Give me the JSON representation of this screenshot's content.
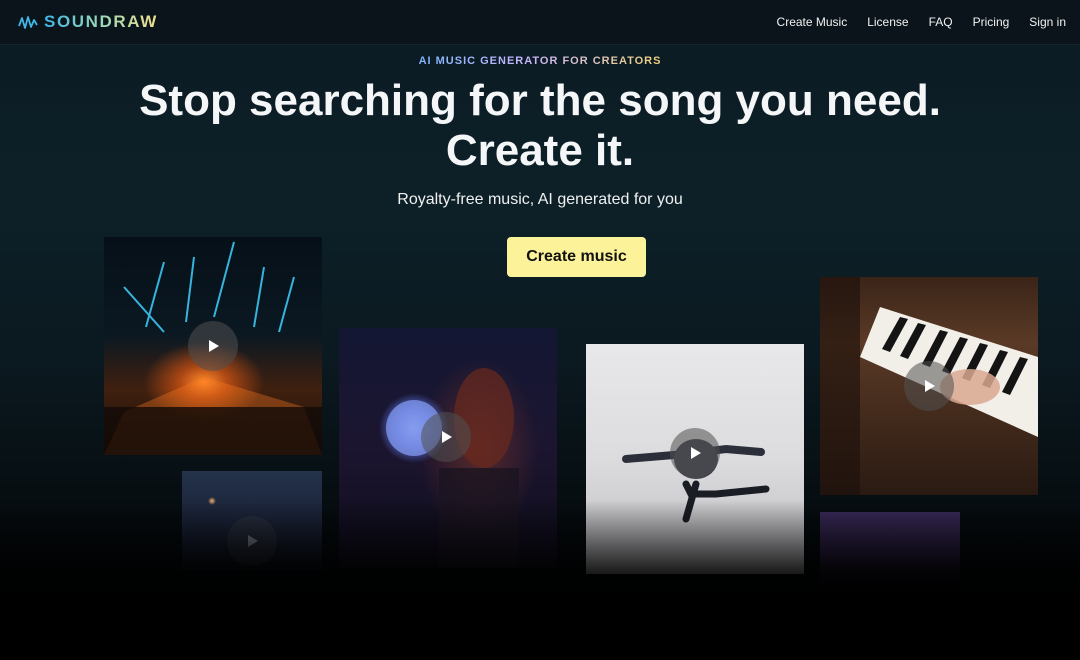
{
  "brand": {
    "name": "SOUNDRAW"
  },
  "nav": {
    "items": [
      "Create Music",
      "License",
      "FAQ",
      "Pricing",
      "Sign in"
    ]
  },
  "hero": {
    "eyebrow": "AI MUSIC GENERATOR FOR CREATORS",
    "headline_line1": "Stop searching for the song you need.",
    "headline_line2": "Create it.",
    "subline": "Royalty-free music, AI generated for you",
    "cta_label": "Create music"
  },
  "colors": {
    "cta_background": "#fbf29a",
    "nav_background": "#0a141a",
    "page_background": "#0b1a22"
  },
  "gallery": {
    "cards": [
      {
        "subject": "concert-stage-lights",
        "has_play": true
      },
      {
        "subject": "woman-disco-ball",
        "has_play": true
      },
      {
        "subject": "dancer-white-room",
        "has_play": true
      },
      {
        "subject": "piano-hands",
        "has_play": true
      },
      {
        "subject": "city-night-aerial",
        "has_play": true
      },
      {
        "subject": "purple-sunset-palms",
        "has_play": false
      }
    ]
  }
}
